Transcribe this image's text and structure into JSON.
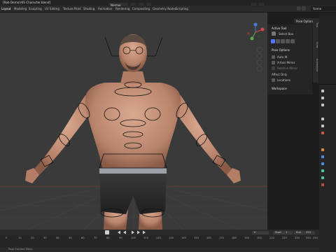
{
  "window": {
    "title": "[Rob Demo\\rKS Character.blend]"
  },
  "menu": {
    "tabs": [
      "Layout",
      "Modeling",
      "Sculpting",
      "UV Editing",
      "Texture Paint",
      "Shading",
      "Animation",
      "Rendering",
      "Compositing",
      "Geometry Nodes",
      "Scripting"
    ],
    "scene_label": "Scene"
  },
  "viewport_header": {
    "view_label": "Normal",
    "pose_options_label": "Pose Options"
  },
  "tool_panel": {
    "active_tool": "Active Tool",
    "select_box": "Select Box",
    "pose_options": "Pose Options",
    "auto_ik": "Auto IK",
    "x_axis_mirror": "X-Axis Mirror",
    "relative_mirror": "Relative Mirror",
    "affect_only": "Affect Only",
    "locations": "Locations",
    "workspace": "Workspace"
  },
  "side_tabs": [
    "Tool",
    "View",
    "Animation"
  ],
  "timeline": {
    "ruler": [
      "0",
      "10",
      "20",
      "30",
      "40",
      "50",
      "60",
      "70",
      "80",
      "90",
      "100",
      "110",
      "120",
      "130",
      "140",
      "150",
      "160",
      "170",
      "180",
      "190",
      "200",
      "210",
      "220",
      "230",
      "240",
      "250"
    ],
    "start_label": "Start",
    "start_value": "1",
    "end_label": "End",
    "end_value": "250",
    "current_frame": "0"
  },
  "status": {
    "text": "Pose Context Menu"
  },
  "colors": {
    "accent": "#4f76ff",
    "viewport_bg": "#3a3a3a",
    "bone_outline": "#111111"
  }
}
